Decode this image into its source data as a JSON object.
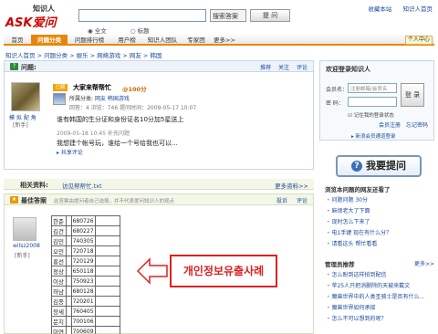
{
  "header": {
    "logo_top": "知识人",
    "logo_main": "ASK爱问",
    "search_select": "搜索答案",
    "search_button": "提 问",
    "radio_all": "全文",
    "radio_title": "标题",
    "links": [
      "收藏本站",
      "知识人首页"
    ]
  },
  "nav": {
    "items": [
      "首页",
      "问题分类",
      "问题排行榜",
      "用户榜",
      "知识人团队",
      "专家团",
      "更多>>"
    ],
    "my_button": "个人中心"
  },
  "breadcrumb": "知识人首页 > 问题分类 > 娱乐 > 网络游戏 > 网友 > 韩国",
  "question": {
    "label": "问题:",
    "ops": [
      "推荐",
      "关注",
      "评论"
    ],
    "user_name": "模 拟 配 角",
    "user_rank": "[新手]",
    "badge": "已解决",
    "title": "大家来帮帮忙",
    "score": "@100分",
    "category_label": "所属分类:",
    "category": "网友 韩国游戏",
    "meta": "回答：4   浏览：746   提问时间：2009-05-17 10:07",
    "body": "谁有韩国的生分证和身份证名10分加5星送上",
    "added": "2009-05-18 10:45 补充问题",
    "added_body": "我想建个帐号玩，谁给一个号给我也可以...",
    "share": "▸ 共享评论"
  },
  "related": {
    "label": "相关资料:",
    "file": "访见帮帮忙.txt",
    "more": "更多资料>>"
  },
  "answer": {
    "label": "最佳答案",
    "note": "此答案由提问者自己选择，并不代表爱问知识人的观点",
    "ops": [
      "投诉",
      "评论"
    ],
    "user_name": "wilsz2008",
    "user_rank": "[新手]",
    "rows": [
      {
        "name": "한준",
        "code": "680726"
      },
      {
        "name": "김건",
        "code": "680227"
      },
      {
        "name": "김민",
        "code": "740305"
      },
      {
        "name": "오민",
        "code": "720718"
      },
      {
        "name": "홍선",
        "code": "720129"
      },
      {
        "name": "정상",
        "code": "650118"
      },
      {
        "name": "이상",
        "code": "750923"
      },
      {
        "name": "하남",
        "code": "680128"
      },
      {
        "name": "김종",
        "code": "720201"
      },
      {
        "name": "장세",
        "code": "760405"
      },
      {
        "name": "문지",
        "code": "700106"
      },
      {
        "name": "이연",
        "code": "700609"
      }
    ],
    "notice": "개인정보유출사례"
  },
  "login": {
    "title": "欢迎登录知识人",
    "member_label": "会员名：",
    "member_placeholder": "注册邮箱/会员名",
    "password_label": "密  码：",
    "button": "登 录",
    "remember": "记住我的登录状态",
    "links": [
      "会员注册",
      "忘记密码"
    ],
    "footer": "▸ 新浪会员通道登录"
  },
  "ask_button": "我要提问",
  "side": {
    "heading1": "浏览本问题的网友还看了",
    "list1": [
      "问题问题 30分",
      "麻烦老大了下面",
      "现时怎么下来了",
      "电1手键 现在有什么分？",
      "请看这头 帮忙看看"
    ],
    "heading2": "管理员推荐",
    "more2": "更多>>",
    "list2": [
      "怎么盼到这样拍到配信",
      "苹25人只把消删除的天被来戴文",
      "魔兽世界中的人类圣骑士是否有什么...",
      "魔兽世界如何承接",
      "怎么不可以想到的呢？"
    ]
  }
}
